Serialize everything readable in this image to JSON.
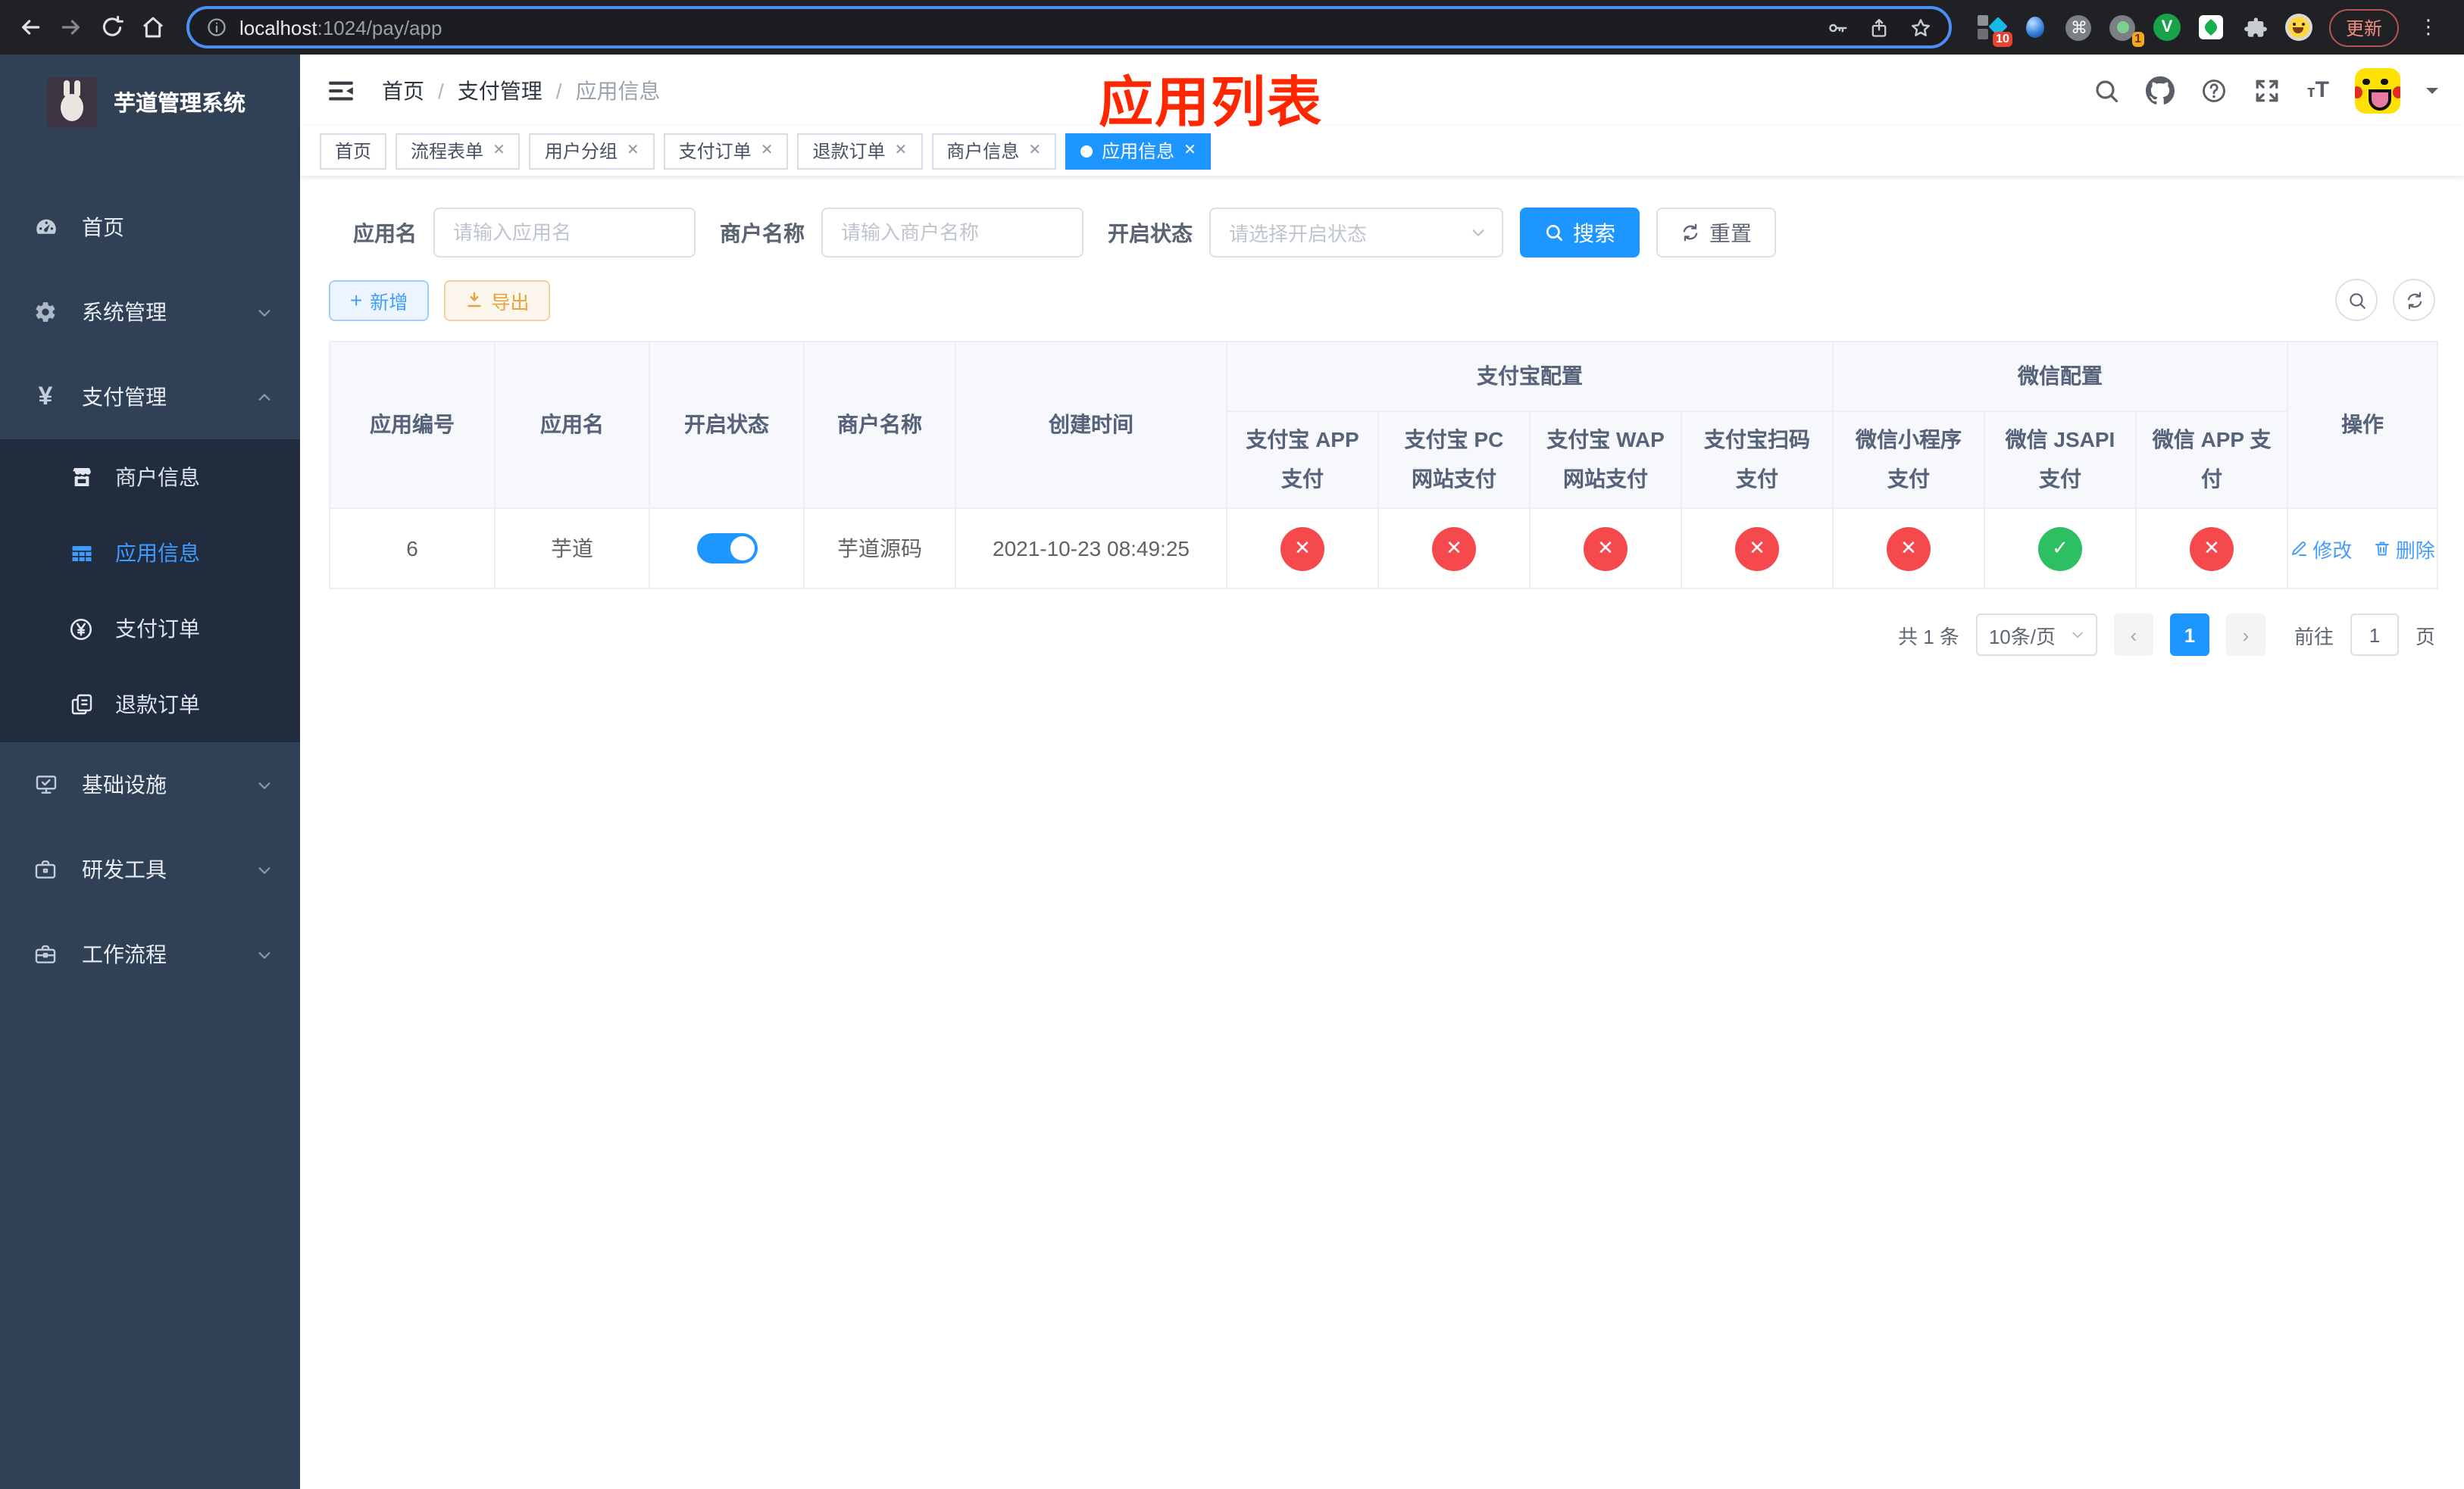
{
  "colors": {
    "primary": "#1e96ff",
    "danger": "#f5494d",
    "success": "#2ebf63",
    "warning": "#e6a23c",
    "sidebar": "#304156"
  },
  "browser": {
    "url_host": "localhost",
    "url_path": ":1024/pay/app",
    "update_label": "更新",
    "ext_badge_10": "10",
    "ext_badge_1": "1",
    "cmd_glyph": "⌘",
    "v_glyph": "V",
    "menu_dots": "⋮"
  },
  "sidebar": {
    "title": "芋道管理系统",
    "items": [
      {
        "label": "首页"
      },
      {
        "label": "系统管理"
      },
      {
        "label": "支付管理"
      },
      {
        "label": "基础设施"
      },
      {
        "label": "研发工具"
      },
      {
        "label": "工作流程"
      }
    ],
    "submenu": [
      {
        "label": "商户信息"
      },
      {
        "label": "应用信息"
      },
      {
        "label": "支付订单"
      },
      {
        "label": "退款订单"
      }
    ],
    "yen_glyph": "¥"
  },
  "header": {
    "breadcrumb": [
      "首页",
      "支付管理",
      "应用信息"
    ],
    "separator": "/",
    "annotation": "应用列表",
    "font_icon": "тT"
  },
  "tabs": [
    {
      "label": "首页"
    },
    {
      "label": "流程表单"
    },
    {
      "label": "用户分组"
    },
    {
      "label": "支付订单"
    },
    {
      "label": "退款订单"
    },
    {
      "label": "商户信息"
    },
    {
      "label": "应用信息"
    }
  ],
  "tab_close_glyph": "✕",
  "filters": {
    "app_name_label": "应用名",
    "app_name_placeholder": "请输入应用名",
    "merchant_label": "商户名称",
    "merchant_placeholder": "请输入商户名称",
    "status_label": "开启状态",
    "status_placeholder": "请选择开启状态",
    "search_label": "搜索",
    "reset_label": "重置"
  },
  "toolbar": {
    "add_label": "新增",
    "export_label": "导出",
    "plus_glyph": "+"
  },
  "table": {
    "columns": [
      "应用编号",
      "应用名",
      "开启状态",
      "商户名称",
      "创建时间"
    ],
    "group_alipay": "支付宝配置",
    "group_wechat": "微信配置",
    "sub_columns": [
      "支付宝 APP 支付",
      "支付宝 PC 网站支付",
      "支付宝 WAP 网站支付",
      "支付宝扫码支付",
      "微信小程序支付",
      "微信 JSAPI 支付",
      "微信 APP 支付"
    ],
    "op_column": "操作",
    "row": {
      "id": "6",
      "name": "芋道",
      "enabled": true,
      "merchant": "芋道源码",
      "created": "2021-10-23 08:49:25",
      "statuses": [
        "fail",
        "fail",
        "fail",
        "fail",
        "fail",
        "success",
        "fail"
      ],
      "edit_label": "修改",
      "delete_label": "删除"
    }
  },
  "pagination": {
    "total": "共 1 条",
    "page_size": "10条/页",
    "prev": "‹",
    "next": "›",
    "current": "1",
    "goto_label": "前往",
    "goto_value": "1",
    "page_unit": "页"
  }
}
